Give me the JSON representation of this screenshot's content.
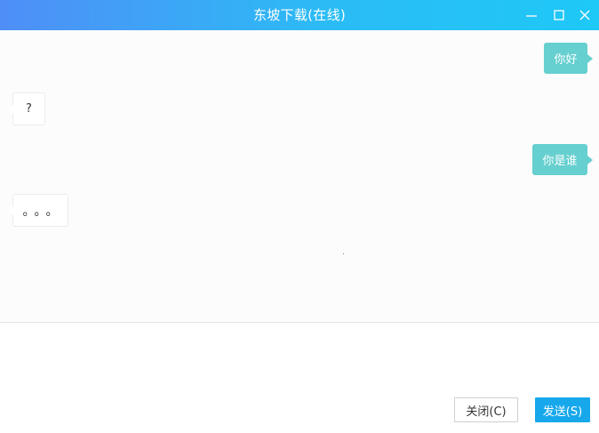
{
  "window": {
    "title": "东坡下载(在线)",
    "controls": {
      "minimize": "minimize-icon",
      "maximize": "maximize-icon",
      "close": "close-icon"
    }
  },
  "messages": [
    {
      "side": "right",
      "text": "你好"
    },
    {
      "side": "left",
      "text": "?"
    },
    {
      "side": "right",
      "text": "你是谁"
    },
    {
      "side": "left",
      "text": "。。。"
    }
  ],
  "input": {
    "value": "",
    "placeholder": ""
  },
  "buttons": {
    "close_label": "关闭(C)",
    "send_label": "发送(S)"
  },
  "colors": {
    "titlebar_start": "#4f8ef7",
    "titlebar_end": "#1ec8f7",
    "outgoing_bubble": "#66cfcf",
    "incoming_bubble": "#ffffff",
    "send_button": "#17a8ec"
  }
}
